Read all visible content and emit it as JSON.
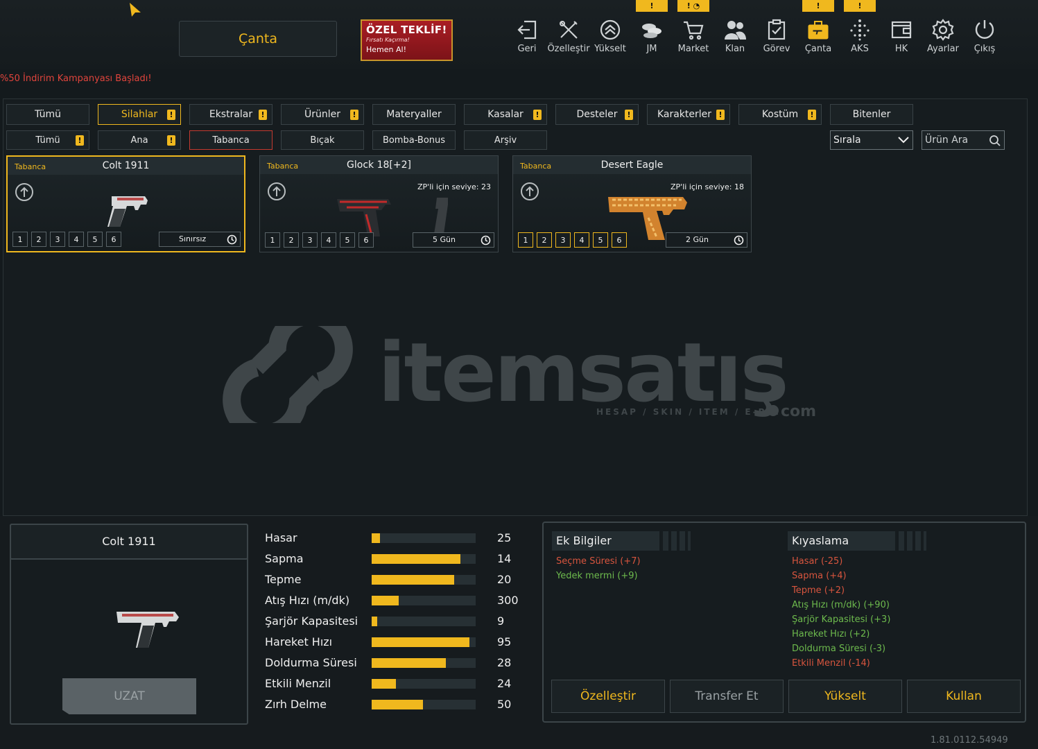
{
  "header": {
    "title": "Çanta",
    "campaign": "%50 İndirim Kampanyası Başladı!"
  },
  "promo": {
    "title": "ÖZEL TEKLİF!",
    "subtitle": "Fırsatı Kaçırma!",
    "cta": "Hemen Al!"
  },
  "nav": [
    {
      "label": "Geri",
      "icon": "back-icon",
      "badge": ""
    },
    {
      "label": "Özelleştir",
      "icon": "tools-icon",
      "badge": ""
    },
    {
      "label": "Yükselt",
      "icon": "upgrade-icon",
      "badge": ""
    },
    {
      "label": "JM",
      "icon": "coins-icon",
      "badge": "!"
    },
    {
      "label": "Market",
      "icon": "cart-icon",
      "badge": "! ◔"
    },
    {
      "label": "Klan",
      "icon": "clan-icon",
      "badge": ""
    },
    {
      "label": "Görev",
      "icon": "clipboard-icon",
      "badge": ""
    },
    {
      "label": "Çanta",
      "icon": "bag-icon",
      "badge": "!"
    },
    {
      "label": "AKS",
      "icon": "dots-icon",
      "badge": "!"
    },
    {
      "label": "HK",
      "icon": "wallet-icon",
      "badge": ""
    },
    {
      "label": "Ayarlar",
      "icon": "gear-icon",
      "badge": ""
    },
    {
      "label": "Çıkış",
      "icon": "power-icon",
      "badge": ""
    }
  ],
  "tabs": [
    {
      "label": "Tümü",
      "warn": ""
    },
    {
      "label": "Silahlar",
      "warn": "!"
    },
    {
      "label": "Ekstralar",
      "warn": "!"
    },
    {
      "label": "Ürünler",
      "warn": "!"
    },
    {
      "label": "Materyaller",
      "warn": ""
    },
    {
      "label": "Kasalar",
      "warn": "!"
    },
    {
      "label": "Desteler",
      "warn": "!"
    },
    {
      "label": "Karakterler",
      "warn": "!"
    },
    {
      "label": "Kostüm",
      "warn": "!"
    },
    {
      "label": "Bitenler",
      "warn": ""
    }
  ],
  "subtabs": [
    {
      "label": "Tümü",
      "warn": "!"
    },
    {
      "label": "Ana",
      "warn": "!"
    },
    {
      "label": "Tabanca",
      "warn": ""
    },
    {
      "label": "Bıçak",
      "warn": ""
    },
    {
      "label": "Bomba-Bonus",
      "warn": ""
    },
    {
      "label": "Arşiv",
      "warn": ""
    }
  ],
  "sort": {
    "label": "Sırala"
  },
  "search": {
    "placeholder": "Ürün Ara"
  },
  "cards": [
    {
      "category": "Tabanca",
      "name": "Colt 1911",
      "req": "",
      "slots": [
        "1",
        "2",
        "3",
        "4",
        "5",
        "6"
      ],
      "duration": "Sınırsız"
    },
    {
      "category": "Tabanca",
      "name": "Glock 18[+2]",
      "req": "ZP'li için seviye: 23",
      "slots": [
        "1",
        "2",
        "3",
        "4",
        "5",
        "6"
      ],
      "duration": "5 Gün"
    },
    {
      "category": "Tabanca",
      "name": "Desert Eagle",
      "req": "ZP'li için seviye: 18",
      "slots": [
        "1",
        "2",
        "3",
        "4",
        "5",
        "6"
      ],
      "duration": "2 Gün"
    }
  ],
  "watermark": {
    "brand": "itemsatış",
    "tagline": "HESAP / SKIN / ITEM / E-PIN",
    "suffix": "com"
  },
  "preview": {
    "name": "Colt 1911",
    "extend_label": "UZAT"
  },
  "stats": [
    {
      "label": "Hasar",
      "value": "25",
      "fill": 0.08
    },
    {
      "label": "Sapma",
      "value": "14",
      "fill": 0.85
    },
    {
      "label": "Tepme",
      "value": "20",
      "fill": 0.79
    },
    {
      "label": "Atış Hızı (m/dk)",
      "value": "300",
      "fill": 0.26
    },
    {
      "label": "Şarjör Kapasitesi",
      "value": "9",
      "fill": 0.05
    },
    {
      "label": "Hareket Hızı",
      "value": "95",
      "fill": 0.94
    },
    {
      "label": "Doldurma Süresi",
      "value": "28",
      "fill": 0.71
    },
    {
      "label": "Etkili Menzil",
      "value": "24",
      "fill": 0.23
    },
    {
      "label": "Zırh Delme",
      "value": "50",
      "fill": 0.49
    }
  ],
  "extra_info": {
    "title": "Ek Bilgiler",
    "lines": [
      {
        "text": "Seçme Süresi (+7)",
        "tone": "red"
      },
      {
        "text": "Yedek mermi (+9)",
        "tone": "green"
      }
    ]
  },
  "compare": {
    "title": "Kıyaslama",
    "lines": [
      {
        "text": "Hasar (-25)",
        "tone": "red"
      },
      {
        "text": "Sapma (+4)",
        "tone": "red"
      },
      {
        "text": "Tepme (+2)",
        "tone": "red"
      },
      {
        "text": "Atış Hızı (m/dk) (+90)",
        "tone": "green"
      },
      {
        "text": "Şarjör Kapasitesi (+3)",
        "tone": "green"
      },
      {
        "text": "Hareket Hızı (+2)",
        "tone": "green"
      },
      {
        "text": "Doldurma Süresi (-3)",
        "tone": "green"
      },
      {
        "text": "Etkili Menzil (-14)",
        "tone": "red"
      }
    ]
  },
  "actions": [
    "Özelleştir",
    "Transfer Et",
    "Yükselt",
    "Kullan"
  ],
  "version": "1.81.0112.54949",
  "colors": {
    "accent": "#f0b81e",
    "negative": "#d8553e",
    "positive": "#6dba4d",
    "danger": "#c53a30"
  }
}
